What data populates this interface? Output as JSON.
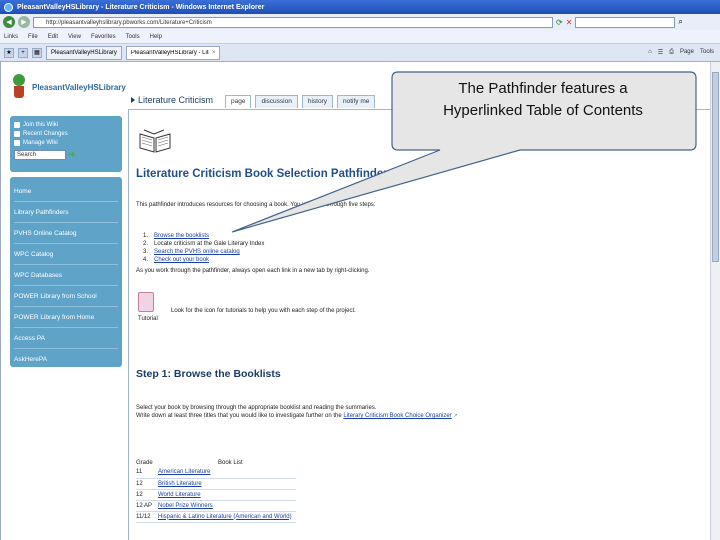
{
  "browser": {
    "window_title": "PleasantValleyHSLibrary - Literature Criticism - Windows Internet Explorer",
    "url": "http://pleasantvalleyhslibrary.pbworks.com/Literature+Criticism",
    "search_placeholder": "",
    "links_label": "Links",
    "menu": [
      "File",
      "Edit",
      "View",
      "Favorites",
      "Tools",
      "Help"
    ],
    "tabs": [
      {
        "label": "PleasantValleyHSLibrary"
      },
      {
        "label": "PleasantValleyHSLibrary - Literature Criticism"
      }
    ],
    "tools": [
      "Page",
      "Tools"
    ]
  },
  "sidebar": {
    "logo_text": "PleasantValleyHSLibrary",
    "user_links": [
      "Join this Wiki",
      "Recent Changes",
      "Manage Wiki"
    ],
    "search_placeholder": "Search",
    "nav": [
      "Home",
      "Library Pathfinders",
      "PVHS Online Catalog",
      "WPC Catalog",
      "WPC Databases",
      "POWER Library from School",
      "POWER Library from Home",
      "Access PA",
      "AskHerePA"
    ]
  },
  "wiki": {
    "page_title": "Literature Criticism",
    "tabs": [
      "page",
      "discussion",
      "history",
      "notify me"
    ]
  },
  "content": {
    "heading": "Literature Criticism Book Selection Pathfinder",
    "intro": "This pathfinder introduces resources for choosing a book. You will work through five steps:",
    "steps": [
      {
        "num": "1.",
        "text": "Browse the booklists"
      },
      {
        "num": "2.",
        "text": "Locate criticism at the Gale Literary Index"
      },
      {
        "num": "3.",
        "text": "Search the PVHS online catalog"
      },
      {
        "num": "4.",
        "text": "Check out your book"
      }
    ],
    "after_steps": "As you work through the pathfinder, always open each link in a new tab by right-clicking.",
    "tutorial_label": "Tutorial",
    "tutorial_text": "Look for the icon for tutorials to help you with each step of the project.",
    "step1_heading": "Step 1: Browse the Booklists",
    "step1_line1": "Select your book by browsing through the appropriate booklist and reading the summaries.",
    "step1_line2_prefix": "Write down at least three titles that you would like to investigate further on the",
    "step1_line2_link": "Literary Criticism Book Choice Organizer",
    "table": {
      "headers": [
        "Grade",
        "Book List"
      ],
      "rows": [
        {
          "grade": "11",
          "list": "American Literature"
        },
        {
          "grade": "12",
          "list": "British Literature"
        },
        {
          "grade": "12",
          "list": "World Literature"
        },
        {
          "grade": "12 AP",
          "list": "Nobel Prize Winners"
        },
        {
          "grade": "11/12",
          "list": "Hispanic & Latino Literature (American and World)"
        }
      ]
    }
  },
  "callout": {
    "text_line1": "The Pathfinder features a",
    "text_line2": "Hyperlinked Table of Contents"
  },
  "colors": {
    "sidebar_box": "#5fa3c9",
    "heading": "#1f4e8c",
    "link": "#1a3fa6"
  }
}
